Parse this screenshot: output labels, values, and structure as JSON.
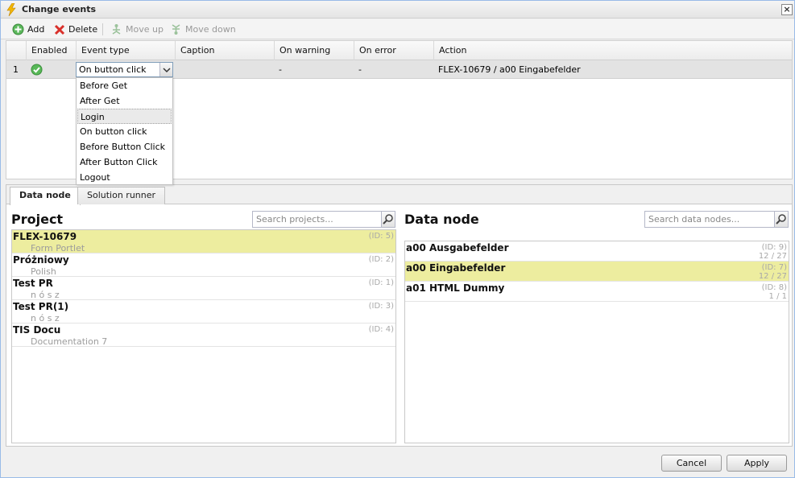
{
  "window": {
    "title": "Change events",
    "close_label": "×"
  },
  "toolbar": {
    "add": "Add",
    "delete": "Delete",
    "move_up": "Move up",
    "move_down": "Move down"
  },
  "grid": {
    "columns": [
      "Enabled",
      "Event type",
      "Caption",
      "On warning",
      "On error",
      "Action"
    ],
    "rows": [
      {
        "num": "1",
        "event_type": "On button click",
        "caption": "",
        "on_warning": "-",
        "on_error": "-",
        "action": "FLEX-10679 / a00 Eingabefelder"
      }
    ]
  },
  "dropdown": {
    "options": [
      "Before Get",
      "After Get",
      "Login",
      "On button click",
      "Before Button Click",
      "After Button Click",
      "Logout"
    ],
    "highlighted": "Login"
  },
  "tabs": [
    "Data node",
    "Solution runner"
  ],
  "project_pane": {
    "title": "Project",
    "search_placeholder": "Search projects...",
    "items": [
      {
        "name": "FLEX-10679",
        "sub": "Form Portlet",
        "id": "(ID: 5)"
      },
      {
        "name": "Próżniowy",
        "sub": "Polish",
        "id": "(ID: 2)"
      },
      {
        "name": "Test PR",
        "sub": "n ó s z",
        "id": "(ID: 1)"
      },
      {
        "name": "Test PR(1)",
        "sub": "n ó s z",
        "id": "(ID: 3)"
      },
      {
        "name": "TIS Docu",
        "sub": "Documentation 7",
        "id": "(ID: 4)"
      }
    ]
  },
  "datanode_pane": {
    "title": "Data node",
    "search_placeholder": "Search data nodes...",
    "items": [
      {
        "name": "a00 Ausgabefelder",
        "id": "(ID: 9)",
        "count": "12 / 27"
      },
      {
        "name": "a00 Eingabefelder",
        "id": "(ID: 7)",
        "count": "12 / 27"
      },
      {
        "name": "a01 HTML Dummy",
        "id": "(ID: 8)",
        "count": "1 / 1"
      }
    ]
  },
  "footer": {
    "cancel": "Cancel",
    "apply": "Apply"
  },
  "colors": {
    "selected_row": "#eded9f",
    "grid_row": "#e3e3e3",
    "accent": "#99bbe8"
  }
}
